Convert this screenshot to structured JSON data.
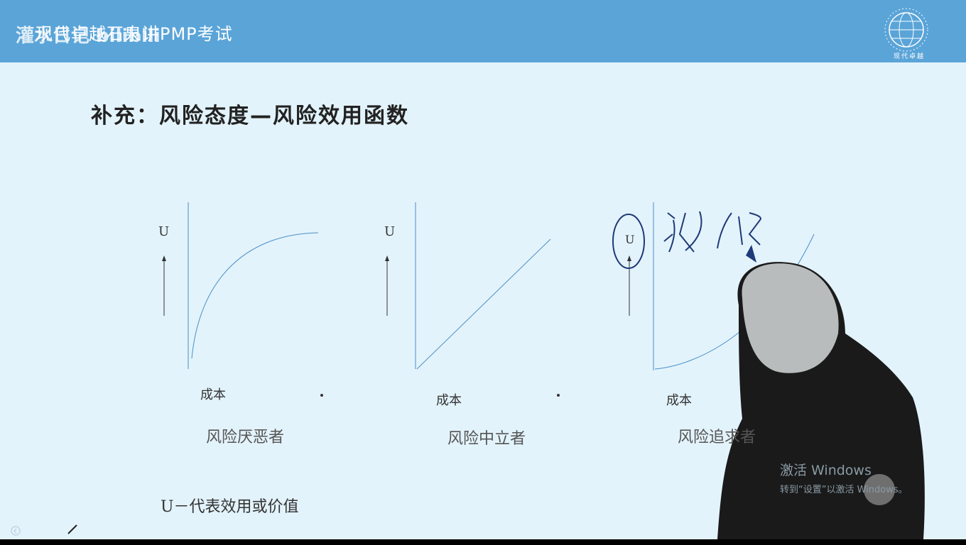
{
  "header": {
    "title": "现代卓越石泉讲PMP考试",
    "watermark": "灌水日记 bilibili",
    "logo_text": "现代卓越"
  },
  "slide": {
    "title": "补充：风险态度—风险效用函数",
    "graphs": [
      {
        "y_label": "U",
        "x_label": "成本",
        "caption": "风险厌恶者"
      },
      {
        "y_label": "U",
        "x_label": "成本",
        "caption": "风险中立者"
      },
      {
        "y_label": "U",
        "x_label": "成本",
        "caption": "风险追求者"
      }
    ],
    "handwriting": "效用",
    "note": "U－代表效用或价值"
  },
  "windows_notice": {
    "line1": "激活 Windows",
    "line2": "转到“设置”以激活 Windows。"
  },
  "colors": {
    "header": "#5aa4d8",
    "slide_bg": "#e3f3fb",
    "line": "#4a8fc8"
  },
  "icons": [
    "pen-icon",
    "slide-nav-icon",
    "globe-logo-icon"
  ]
}
